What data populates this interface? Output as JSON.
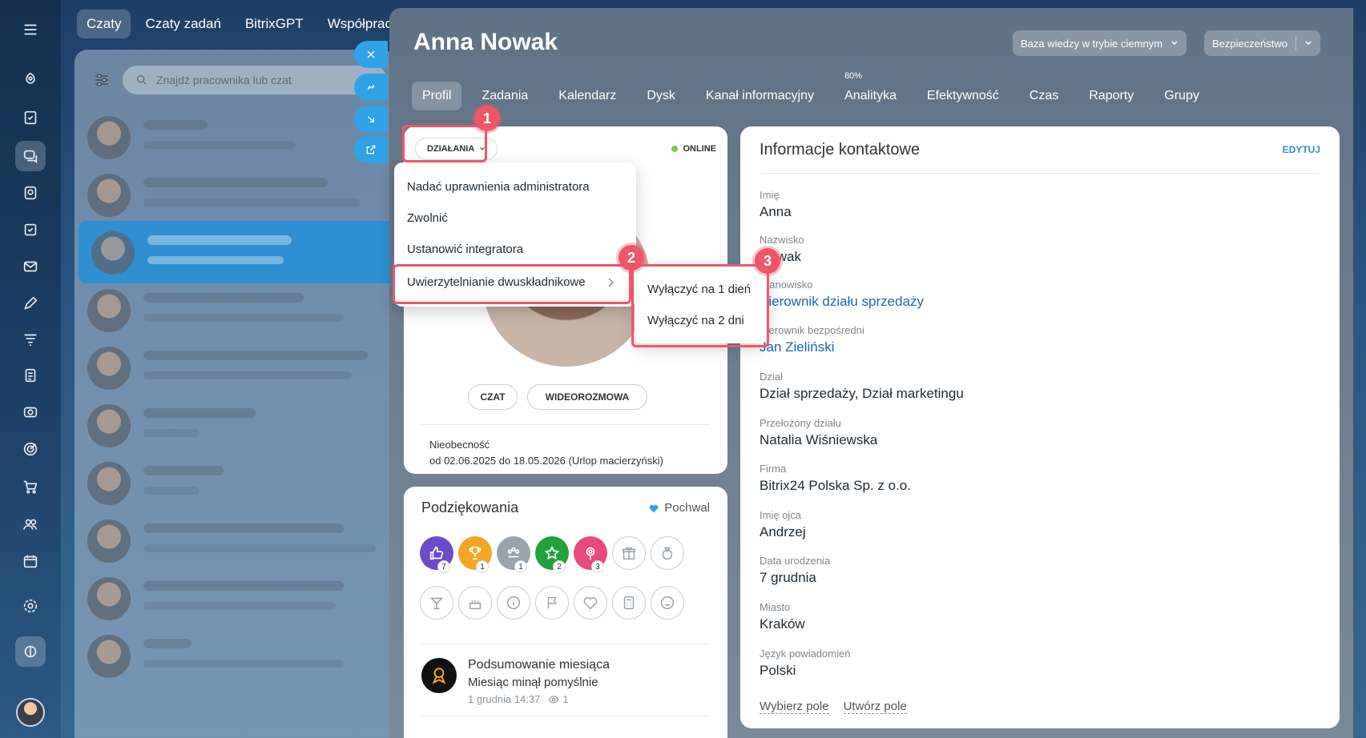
{
  "chat_tabs": [
    "Czaty",
    "Czaty zadań",
    "BitrixGPT",
    "Współpraca"
  ],
  "chat_search": {
    "placeholder": "Znajdź pracownika lub czat"
  },
  "profile": {
    "name": "Anna Nowak",
    "top_buttons": {
      "dark_kb": "Baza wiedzy w trybie ciemnym",
      "security": "Bezpieczeństwo"
    },
    "tabs": [
      "Profil",
      "Zadania",
      "Kalendarz",
      "Dysk",
      "Kanał informacyjny",
      "Analityka",
      "Efektywność",
      "Czas",
      "Raporty",
      "Grupy"
    ],
    "analytics_badge": "80%",
    "actions_label": "DZIAŁANIA",
    "status": "ONLINE",
    "chat_btn": "CZAT",
    "video_btn": "WIDEOROZMOWA",
    "absence_title": "Nieobecność",
    "absence_value": "od 02.06.2025 do 18.05.2026 (Urlop macierzyński)"
  },
  "actions_menu": {
    "items": [
      "Nadać uprawnienia administratora",
      "Zwolnić",
      "Ustanowić integratora",
      "Uwierzytelnianie dwuskładnikowe"
    ],
    "submenu": [
      "Wyłączyć na 1 dień",
      "Wyłączyć na 2 dni"
    ]
  },
  "steps": [
    "1",
    "2",
    "3"
  ],
  "thanks": {
    "title": "Podziękowania",
    "action": "Pochwal",
    "badges_row1": [
      {
        "icon": "thumbs-up-icon",
        "count": "7",
        "color": "#6a4bc9"
      },
      {
        "icon": "trophy-icon",
        "count": "1",
        "color": "#f5a623"
      },
      {
        "icon": "crown-icon",
        "count": "1",
        "color": "#9aa3ab"
      },
      {
        "icon": "star-icon",
        "count": "2",
        "color": "#1fa33c"
      },
      {
        "icon": "flower-icon",
        "count": "3",
        "color": "#e84a7f"
      },
      {
        "icon": "gift-icon",
        "count": "",
        "color": ""
      },
      {
        "icon": "money-bag-icon",
        "count": "",
        "color": ""
      }
    ],
    "post": {
      "title": "Podsumowanie miesiąca",
      "text": "Miesiąc minął pomyślnie",
      "date": "1 grudnia 14:37",
      "views": "1"
    }
  },
  "contact": {
    "title": "Informacje kontaktowe",
    "edit": "EDYTUJ",
    "fields": [
      {
        "label": "Imię",
        "value": "Anna"
      },
      {
        "label": "Nazwisko",
        "value": "Nowak"
      },
      {
        "label": "Stanowisko",
        "value": "Kierownik działu sprzedaży"
      },
      {
        "label": "Kierownik bezpośredni",
        "value": "Jan Zieliński"
      },
      {
        "label": "Dział",
        "value": "Dział sprzedaży, Dział marketingu"
      },
      {
        "label": "Przełożony działu",
        "value": "Natalia Wiśniewska"
      },
      {
        "label": "Firma",
        "value": "Bitrix24 Polska Sp. z o.o."
      },
      {
        "label": "Imię ojca",
        "value": "Andrzej"
      },
      {
        "label": "Data urodzenia",
        "value": "7 grudnia"
      },
      {
        "label": "Miasto",
        "value": "Kraków"
      },
      {
        "label": "Język powiadomień",
        "value": "Polski"
      }
    ],
    "select_field": "Wybierz pole",
    "create_field": "Utwórz pole"
  },
  "colors": {
    "accent": "#2f8fd0",
    "highlight": "#f0566a",
    "online": "#7ac943"
  }
}
